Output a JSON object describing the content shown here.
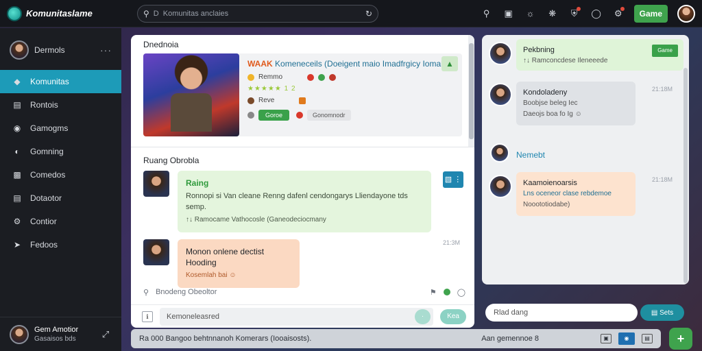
{
  "app": {
    "title": "Komunitaslame"
  },
  "search": {
    "prefix": "D",
    "value": "Komunitas anclaies"
  },
  "topbar": {
    "game_label": "Game"
  },
  "user": {
    "name": "Dermols",
    "more": "···"
  },
  "nav": [
    {
      "label": "Komunitas",
      "icon": "diamond-icon",
      "active": true
    },
    {
      "label": "Rontois",
      "icon": "book-icon"
    },
    {
      "label": "Gamogms",
      "icon": "chat-icon"
    },
    {
      "label": "Gomning",
      "icon": "controller-icon"
    },
    {
      "label": "Comedos",
      "icon": "grid-icon"
    },
    {
      "label": "Dotaotor",
      "icon": "list-icon"
    },
    {
      "label": "Contior",
      "icon": "settings-icon"
    },
    {
      "label": "Fedoos",
      "icon": "pin-icon"
    }
  ],
  "footer_user": {
    "name": "Gem Amotior",
    "status": "Gasaisos bds"
  },
  "feature": {
    "section_title": "Dnednoia",
    "title_highlight": "WAAK",
    "title_rest": "Komeneceils (Doeigent maio Imadfrgicy Iomahasl.",
    "line1": "Remmo",
    "line2": "★★★★★  1  2",
    "line3": "Reve",
    "tag_green": "Goroe",
    "tag_gray": "Gonomnodr"
  },
  "chat": {
    "section_title": "Ruang Obrobla",
    "msg1": {
      "head": "Raing",
      "text": "Ronnopi si Van cleane Renng dafenl cendongarys Lliendayone tds semp.",
      "sub": "↑↓ Ramocame Vathocosle (Ganeodeciocmany"
    },
    "msg1_icon": "▧ ⋮",
    "msg2": {
      "head": "Monon onlene dectist Hooding",
      "sub": "Kosemlah bai ☺"
    },
    "msg2_time": "21:3M",
    "search_placeholder": "Bnodeng Obeoltor",
    "compose_placeholder": "Kemoneleasred",
    "compose_btn": "·",
    "send_label": "Kea"
  },
  "right": {
    "r1": {
      "title": "Pekbning",
      "sub": "↑↓ Ramconcdese Ileneeede",
      "badge": "Game"
    },
    "r2": {
      "title": "Kondoladeny",
      "sub": "Boobjse beleg Iec",
      "sub2": "Daeojs boa fo Ig ☺",
      "time": "21:18M"
    },
    "r3": {
      "label": "Nemebt"
    },
    "r4": {
      "title": "Kaamoienoarsis",
      "sub": "Lns oceneor clase rebdemoe",
      "sub2": "Nooototiodabe)",
      "time": "21:18M"
    },
    "compose_placeholder": "Rlad dang",
    "send_label": "▤ Sets"
  },
  "bottombar": {
    "text": "Ra 000 Bangoo behtnnanoh Komerars (Iooaisosts).",
    "right_text": "Aan gemennoe 8"
  },
  "colors": {
    "accent": "#1d9bb8",
    "green": "#3fa34d",
    "topbar": "#15171c"
  }
}
